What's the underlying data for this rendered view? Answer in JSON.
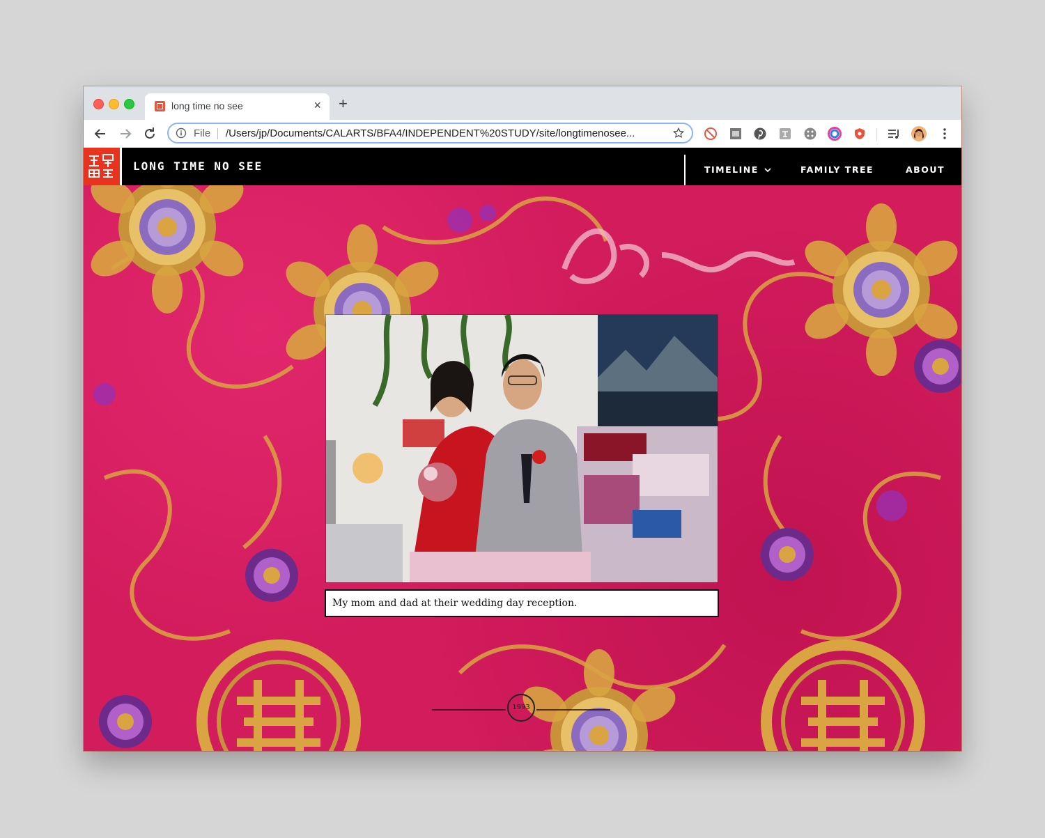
{
  "browser": {
    "tab_title": "long time no see",
    "new_tab_label": "+",
    "close_label": "×",
    "file_label": "File",
    "url": "/Users/jp/Documents/CALARTS/BFA4/INDEPENDENT%20STUDY/site/longtimenosee..."
  },
  "site": {
    "title": "LONG TIME NO SEE",
    "nav": {
      "timeline": "TIMELINE",
      "family_tree": "FAMILY TREE",
      "about": "ABOUT"
    },
    "caption": "My mom and dad at their wedding day reception.",
    "year": "1993"
  },
  "colors": {
    "brand_red": "#e8341f",
    "fabric_pink": "#d21c5c",
    "embroidery_gold": "#d9a441"
  }
}
